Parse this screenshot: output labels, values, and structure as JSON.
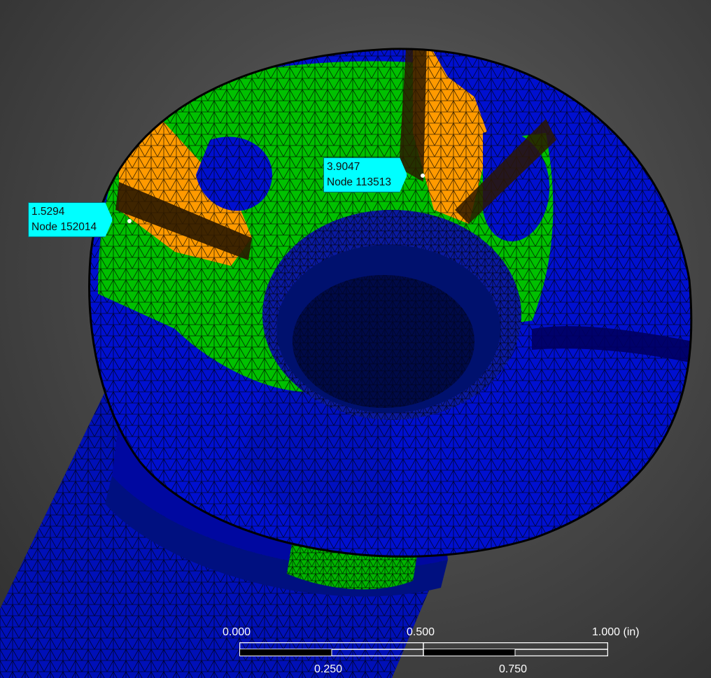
{
  "viewport": {
    "background_color": "#4a4a4a",
    "mesh_color": "#000000",
    "contour_colors": [
      "#0000ff",
      "#00c800",
      "#ff9900"
    ]
  },
  "probes": [
    {
      "value": "1.5294",
      "node": "Node 152014"
    },
    {
      "value": "3.9047",
      "node": "Node 113513"
    }
  ],
  "scale_bar": {
    "top_labels": [
      "0.000",
      "0.500",
      "1.000 (in)"
    ],
    "bottom_labels": [
      "0.250",
      "0.750"
    ]
  }
}
